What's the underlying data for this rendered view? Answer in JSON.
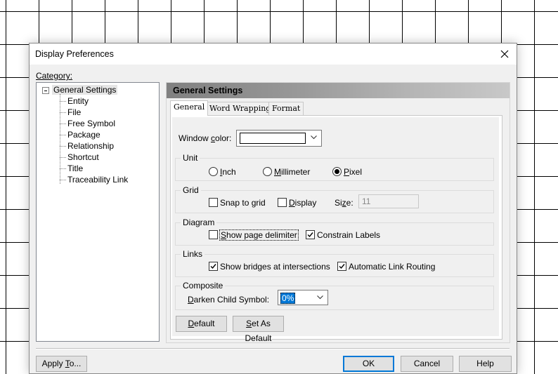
{
  "dialog": {
    "title": "Display Preferences"
  },
  "category": {
    "label": "Category:",
    "root": "General Settings",
    "items": [
      "Entity",
      "File",
      "Free Symbol",
      "Package",
      "Relationship",
      "Shortcut",
      "Title",
      "Traceability Link"
    ]
  },
  "panel": {
    "header": "General Settings",
    "tabs": [
      "General",
      "Word Wrapping",
      "Format"
    ],
    "window_color_label": "Window color:",
    "unit": {
      "label": "Unit",
      "options": [
        "Inch",
        "Millimeter",
        "Pixel"
      ],
      "selected": "Pixel"
    },
    "grid": {
      "label": "Grid",
      "snap_label": "Snap to grid",
      "display_label": "Display",
      "size_label": "Size:",
      "size_value": "11"
    },
    "diagram": {
      "label": "Diagram",
      "show_page_delimiter": "Show page delimiter",
      "constrain_labels": "Constrain Labels"
    },
    "links": {
      "label": "Links",
      "show_bridges": "Show bridges at intersections",
      "auto_routing": "Automatic Link Routing"
    },
    "composite": {
      "label": "Composite",
      "darken_label": "Darken Child Symbol:",
      "darken_value": "0%"
    },
    "default_button": "Default",
    "set_as_default_button": "Set As Default"
  },
  "footer": {
    "apply_to": "Apply To...",
    "ok": "OK",
    "cancel": "Cancel",
    "help": "Help"
  },
  "colors": {
    "window_color": "#ffffff",
    "accent": "#0078d7",
    "selected_text_bg": "#0078d7"
  },
  "icons": {
    "close": "close-icon",
    "tree_collapse": "minus-box-icon",
    "dropdown": "chevron-down-icon",
    "check": "checkmark-icon"
  }
}
